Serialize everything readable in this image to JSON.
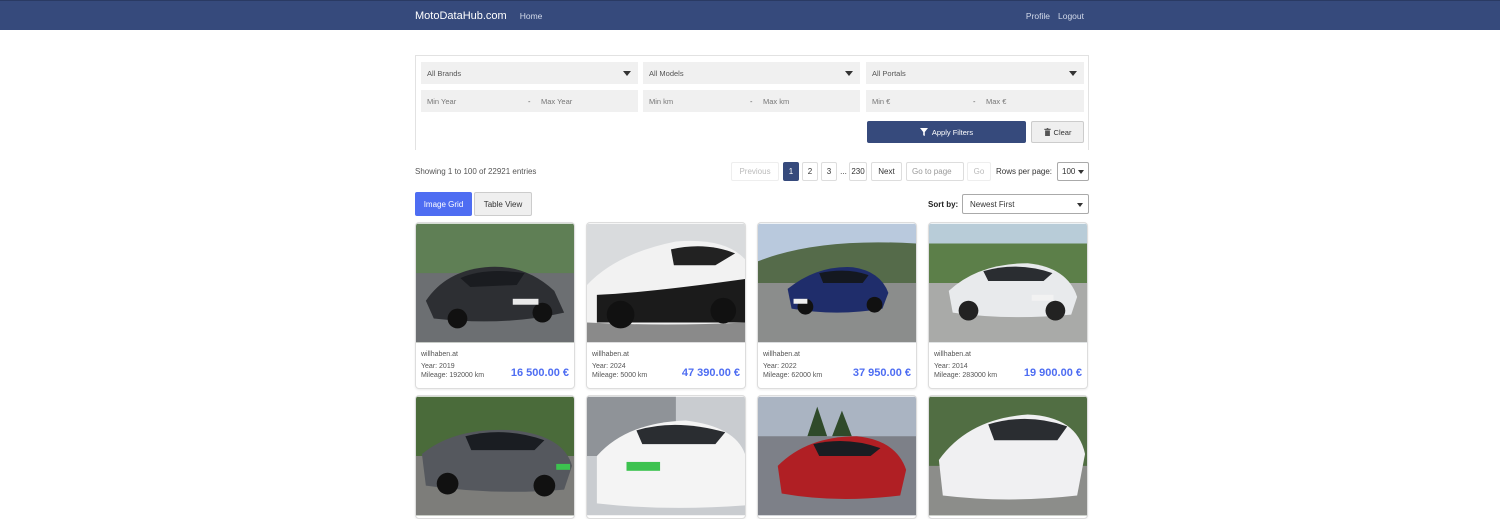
{
  "nav": {
    "brand": "MotoDataHub.com",
    "home": "Home",
    "profile": "Profile",
    "logout": "Logout",
    "bg_color": "#364a7c"
  },
  "filters": {
    "brand": "All Brands",
    "model": "All Models",
    "portal": "All Portals",
    "min_year": "Min Year",
    "max_year": "Max Year",
    "min_km": "Min km",
    "max_km": "Max km",
    "min_price": "Min €",
    "max_price": "Max €",
    "separator": "-",
    "apply": "Apply Filters",
    "clear": "Clear"
  },
  "listing": {
    "showing": "Showing 1 to 100 of 22921 entries",
    "pagination": {
      "previous": "Previous",
      "pages": [
        "1",
        "2",
        "3"
      ],
      "ellipsis": "...",
      "last": "230",
      "next": "Next",
      "goto_placeholder": "Go to page",
      "go": "Go"
    },
    "rows_label": "Rows per page:",
    "rows_value": "100",
    "view_tabs": {
      "grid": "Image Grid",
      "table": "Table View"
    },
    "sort_label": "Sort by:",
    "sort_value": "Newest First"
  },
  "cars": [
    {
      "portal": "willhaben.at",
      "year": "Year: 2019",
      "mileage": "Mileage: 192000 km",
      "price": "16 500.00 €",
      "color": "#2d2f33"
    },
    {
      "portal": "willhaben.at",
      "year": "Year: 2024",
      "mileage": "Mileage: 5000 km",
      "price": "47 390.00 €",
      "color": "#f2f2f2"
    },
    {
      "portal": "willhaben.at",
      "year": "Year: 2022",
      "mileage": "Mileage: 62000 km",
      "price": "37 950.00 €",
      "color": "#1f2d6b"
    },
    {
      "portal": "willhaben.at",
      "year": "Year: 2014",
      "mileage": "Mileage: 283000 km",
      "price": "19 900.00 €",
      "color": "#e8eaec"
    },
    {
      "color": "#55585e"
    },
    {
      "color": "#f4f4f4"
    },
    {
      "color": "#b01f24"
    },
    {
      "color": "#f0f0f2"
    }
  ],
  "accent_color": "#4e6df2"
}
